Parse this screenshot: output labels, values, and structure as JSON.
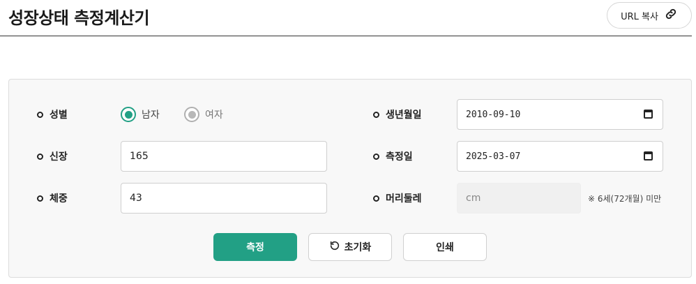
{
  "header": {
    "title": "성장상태 측정계산기",
    "url_button_label": "URL 복사"
  },
  "form": {
    "gender": {
      "label": "성별",
      "options": [
        {
          "label": "남자",
          "selected": true
        },
        {
          "label": "여자",
          "selected": false
        }
      ]
    },
    "height": {
      "label": "신장",
      "value": "165"
    },
    "weight": {
      "label": "체중",
      "value": "43"
    },
    "birthdate": {
      "label": "생년월일",
      "value": "2010-09-10"
    },
    "measure_date": {
      "label": "측정일",
      "value": "2025-03-07"
    },
    "head_circumference": {
      "label": "머리둘레",
      "placeholder": "cm",
      "note": "※ 6세(72개월) 미만"
    }
  },
  "actions": {
    "measure": "측정",
    "reset": "초기화",
    "print": "인쇄"
  },
  "colors": {
    "accent": "#22a085"
  },
  "icons": {
    "copy_link": "link-icon",
    "reset": "refresh-icon",
    "calendar": "calendar-icon"
  }
}
